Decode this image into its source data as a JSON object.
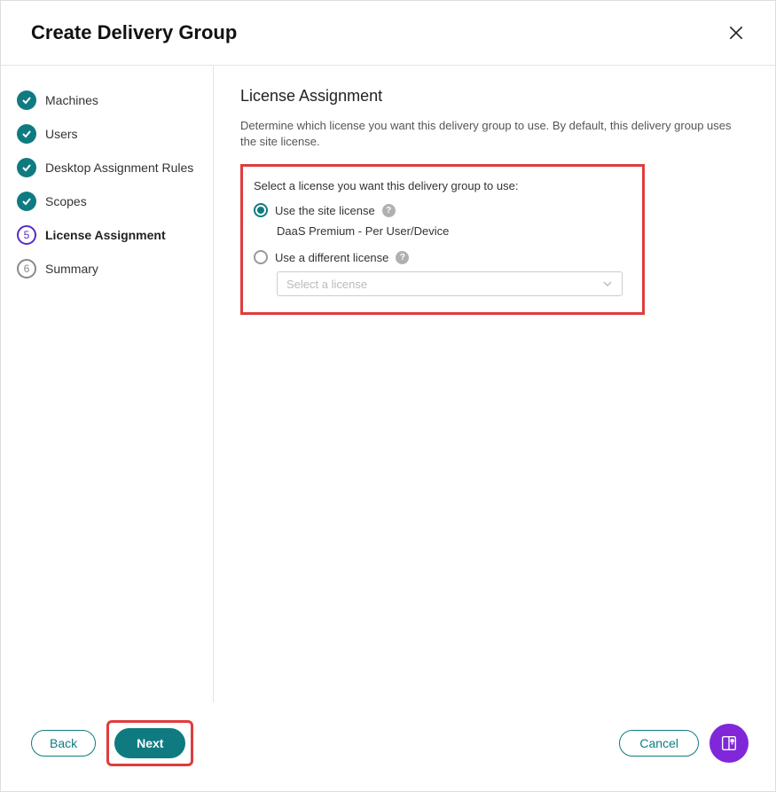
{
  "header": {
    "title": "Create Delivery Group"
  },
  "sidebar": {
    "steps": {
      "machines": "Machines",
      "users": "Users",
      "desktop_rules": "Desktop Assignment Rules",
      "scopes": "Scopes",
      "license": "License Assignment",
      "summary": "Summary",
      "current_num": "5",
      "pending_num": "6"
    }
  },
  "content": {
    "heading": "License Assignment",
    "description": "Determine which license you want this delivery group to use. By default, this delivery group uses the site license.",
    "select_label": "Select a license you want this delivery group to use:",
    "radio1_label": "Use the site license",
    "radio1_value": "DaaS Premium - Per User/Device",
    "radio2_label": "Use a different license",
    "select_placeholder": "Select a license"
  },
  "footer": {
    "back": "Back",
    "next": "Next",
    "cancel": "Cancel"
  }
}
